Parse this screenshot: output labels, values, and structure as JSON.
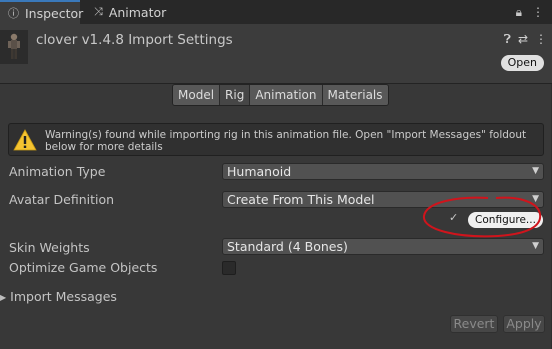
{
  "tabs": [
    {
      "label": "Inspector",
      "icon": "info-icon"
    },
    {
      "label": "Animator",
      "icon": "animator-icon"
    }
  ],
  "tabbar_icons": [
    "lock-icon",
    "kebab-menu-icon"
  ],
  "header": {
    "title": "clover v1.4.8 Import Settings",
    "open_label": "Open",
    "icons": [
      "help-icon",
      "preset-icon",
      "more-icon"
    ]
  },
  "segmented_tabs": [
    {
      "label": "Model",
      "active": false
    },
    {
      "label": "Rig",
      "active": true
    },
    {
      "label": "Animation",
      "active": false
    },
    {
      "label": "Materials",
      "active": false
    }
  ],
  "warning": {
    "text": "Warning(s) found while importing rig in this animation file. Open \"Import Messages\" foldout below for more details",
    "icon": "warning-icon",
    "color": "#f5c431"
  },
  "fields": {
    "animation_type": {
      "label": "Animation Type",
      "value": "Humanoid"
    },
    "avatar_definition": {
      "label": "Avatar Definition",
      "value": "Create From This Model"
    },
    "configure_label": "Configure...",
    "skin_weights": {
      "label": "Skin Weights",
      "value": "Standard (4 Bones)"
    },
    "optimize": {
      "label": "Optimize Game Objects",
      "checked": false
    }
  },
  "foldout": {
    "label": "Import Messages",
    "expanded": false
  },
  "buttons": {
    "revert": "Revert",
    "apply": "Apply"
  },
  "annotation_color": "#d0141c",
  "accent": "#3a79bb"
}
